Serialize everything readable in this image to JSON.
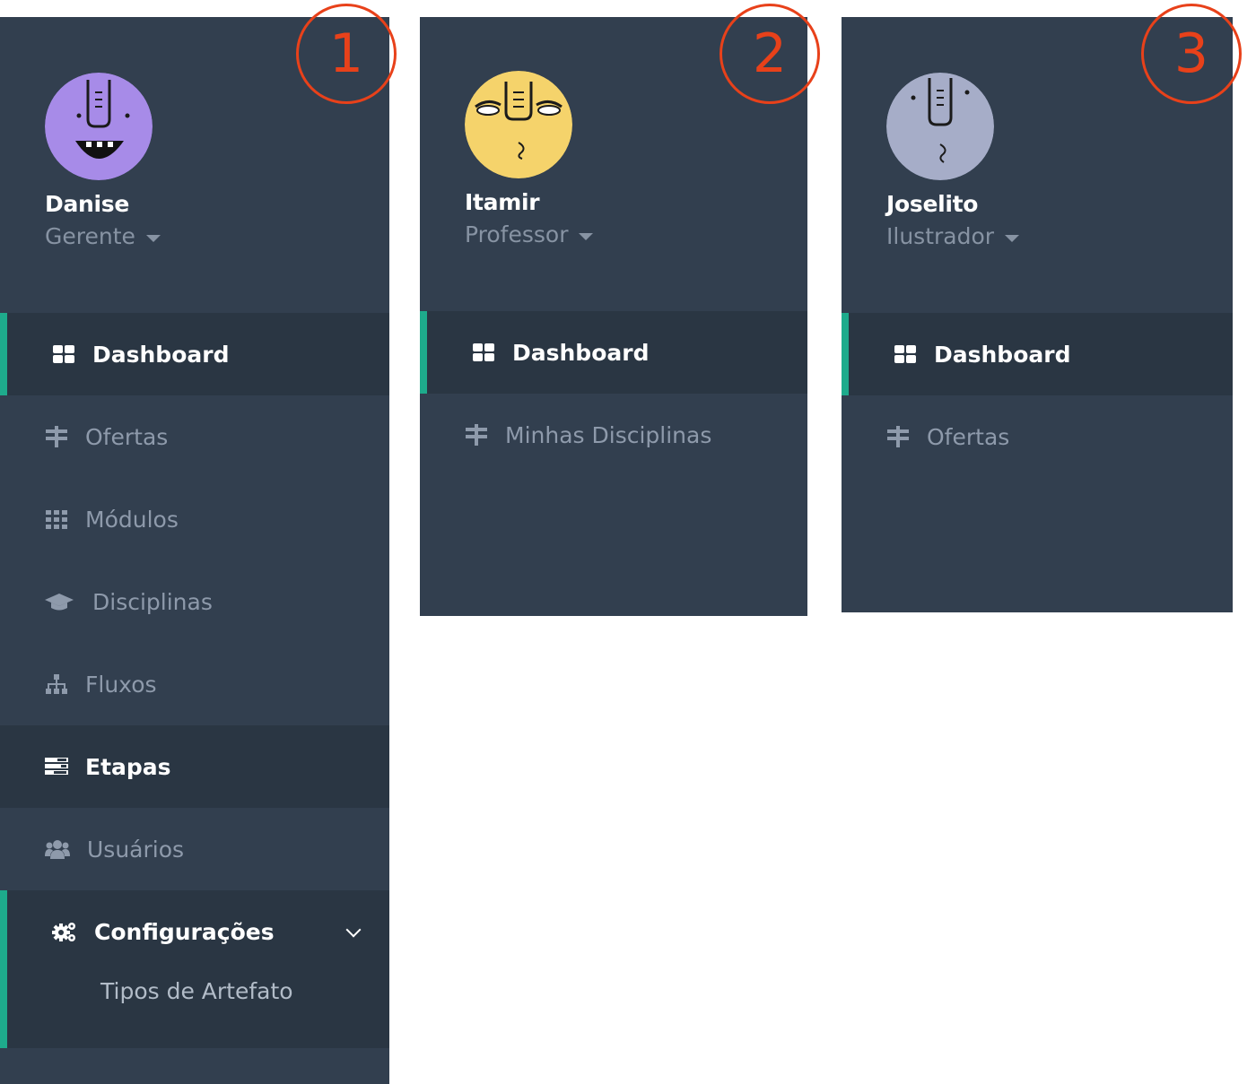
{
  "panels": [
    {
      "badge": "1",
      "user": {
        "name": "Danise",
        "role": "Gerente",
        "avatar_color": "#a78be8"
      },
      "nav": [
        {
          "label": "Dashboard",
          "icon": "dashboard-icon",
          "state": "active"
        },
        {
          "label": "Ofertas",
          "icon": "signpost-icon",
          "state": "normal"
        },
        {
          "label": "Módulos",
          "icon": "grid-icon",
          "state": "normal"
        },
        {
          "label": "Disciplinas",
          "icon": "graduation-cap-icon",
          "state": "normal"
        },
        {
          "label": "Fluxos",
          "icon": "sitemap-icon",
          "state": "normal"
        },
        {
          "label": "Etapas",
          "icon": "tasks-icon",
          "state": "highlighted"
        },
        {
          "label": "Usuários",
          "icon": "users-icon",
          "state": "normal"
        }
      ],
      "group": {
        "label": "Configurações",
        "icon": "gears-icon",
        "expanded": true,
        "children": [
          "Tipos de Artefato"
        ]
      }
    },
    {
      "badge": "2",
      "user": {
        "name": "Itamir",
        "role": "Professor",
        "avatar_color": "#f5d36b"
      },
      "nav": [
        {
          "label": "Dashboard",
          "icon": "dashboard-icon",
          "state": "active"
        },
        {
          "label": "Minhas Disciplinas",
          "icon": "signpost-icon",
          "state": "normal"
        }
      ]
    },
    {
      "badge": "3",
      "user": {
        "name": "Joselito",
        "role": "Ilustrador",
        "avatar_color": "#a6adc8"
      },
      "nav": [
        {
          "label": "Dashboard",
          "icon": "dashboard-icon",
          "state": "active"
        },
        {
          "label": "Ofertas",
          "icon": "signpost-icon",
          "state": "normal"
        }
      ]
    }
  ],
  "colors": {
    "sidebar_bg": "#323f4f",
    "active_bg": "#2a3643",
    "accent": "#1eab8c",
    "badge": "#e8411a",
    "muted_text": "#8e9aab"
  }
}
